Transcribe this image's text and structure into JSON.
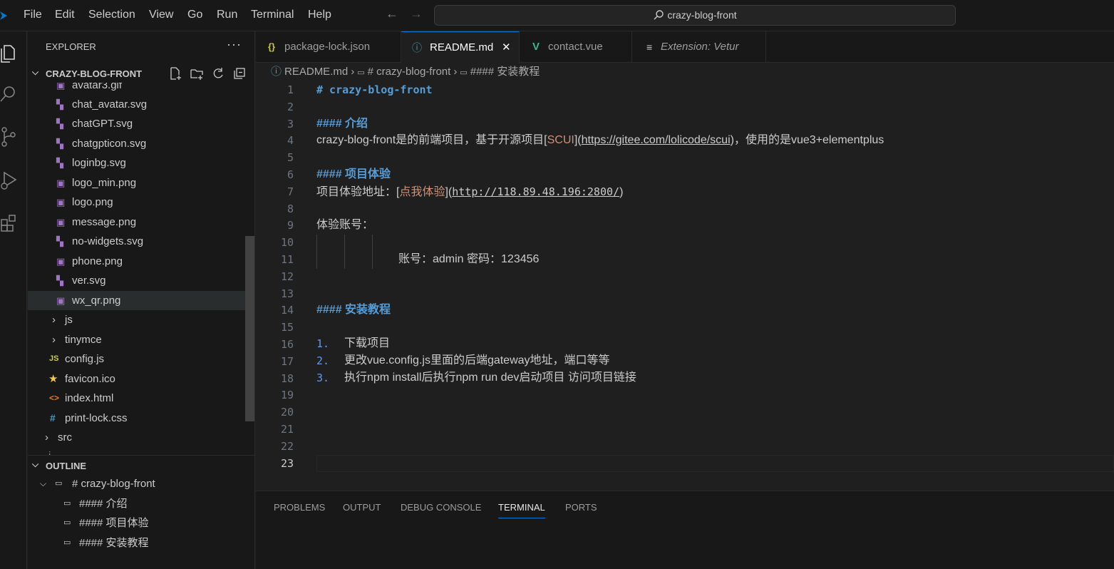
{
  "menu": {
    "items": [
      "File",
      "Edit",
      "Selection",
      "View",
      "Go",
      "Run",
      "Terminal",
      "Help"
    ]
  },
  "command_center": {
    "text": "crazy-blog-front"
  },
  "explorer": {
    "title": "EXPLORER",
    "more": "···",
    "folder": "CRAZY-BLOG-FRONT",
    "files": [
      {
        "name": "avatar3.gif",
        "icon": "image-icon"
      },
      {
        "name": "chat_avatar.svg",
        "icon": "svg-icon"
      },
      {
        "name": "chatGPT.svg",
        "icon": "svg-icon"
      },
      {
        "name": "chatgpticon.svg",
        "icon": "svg-icon"
      },
      {
        "name": "loginbg.svg",
        "icon": "svg-icon"
      },
      {
        "name": "logo_min.png",
        "icon": "image-icon"
      },
      {
        "name": "logo.png",
        "icon": "image-icon"
      },
      {
        "name": "message.png",
        "icon": "image-icon"
      },
      {
        "name": "no-widgets.svg",
        "icon": "svg-icon"
      },
      {
        "name": "phone.png",
        "icon": "image-icon"
      },
      {
        "name": "ver.svg",
        "icon": "svg-icon"
      },
      {
        "name": "wx_qr.png",
        "icon": "image-icon"
      }
    ],
    "folders": [
      "js",
      "tinymce"
    ],
    "root_files": [
      {
        "name": "config.js",
        "icon_text": "JS",
        "color": "#cbcb41"
      },
      {
        "name": "favicon.ico",
        "icon_text": "★",
        "color": "#f2c94c"
      },
      {
        "name": "index.html",
        "icon_text": "<>",
        "color": "#e37933"
      },
      {
        "name": "print-lock.css",
        "icon_text": "#",
        "color": "#519aba"
      }
    ],
    "src": "src",
    "partial": "·i·"
  },
  "outline": {
    "title": "OUTLINE",
    "items": [
      "# crazy-blog-front",
      "#### 介绍",
      "#### 项目体验",
      "#### 安装教程"
    ]
  },
  "tabs": [
    {
      "label": "package-lock.json",
      "icon": "{}",
      "icon_color": "#cbcb41"
    },
    {
      "label": "README.md",
      "icon": "ⓘ",
      "icon_color": "#519aba"
    },
    {
      "label": "contact.vue",
      "icon": "V",
      "icon_color": "#41b883"
    },
    {
      "label": "Extension: Vetur",
      "icon": "≡",
      "icon_color": "#cccccc"
    }
  ],
  "active_tab_close": "✕",
  "breadcrumb": {
    "file": "README.md",
    "sep": "›",
    "h1": "# crazy-blog-front",
    "h4": "#### 安装教程"
  },
  "editor": {
    "line_numbers": [
      "1",
      "2",
      "3",
      "4",
      "5",
      "6",
      "7",
      "8",
      "9",
      "10",
      "11",
      "12",
      "13",
      "14",
      "15",
      "16",
      "17",
      "18",
      "19",
      "20",
      "21",
      "22",
      "23"
    ],
    "l1": "# crazy-blog-front",
    "l3": "#### 介绍",
    "l4_pre": "crazy-blog-front是的前端项目，基于开源项目[",
    "l4_link": "SCUI",
    "l4_mid": "](",
    "l4_url": "https://gitee.com/lolicode/scui",
    "l4_post": ")，使用的是vue3+elementplus",
    "l6": "#### 项目体验",
    "l7_pre": "项目体验地址：[",
    "l7_link": "点我体验",
    "l7_mid": "](",
    "l7_url": "http://118.89.48.196:2800/",
    "l7_post": ")",
    "l9": "体验账号：",
    "l11": "账号：admin 密码：123456",
    "l14": "#### 安装教程",
    "l16_num": "1.",
    "l16": "下载项目",
    "l17_num": "2.",
    "l17": "更改vue.config.js里面的后端gateway地址，端口等等",
    "l18_num": "3.",
    "l18": "执行npm install后执行npm run dev启动项目 访问项目链接"
  },
  "panel": {
    "tabs": [
      "PROBLEMS",
      "OUTPUT",
      "DEBUG CONSOLE",
      "TERMINAL",
      "PORTS"
    ],
    "active": "TERMINAL"
  },
  "colors": {
    "accent": "#0078d4",
    "heading": "#569cd6",
    "link_text": "#ce9178",
    "svg_icon": "#a074c4",
    "image_icon": "#a074c4"
  }
}
